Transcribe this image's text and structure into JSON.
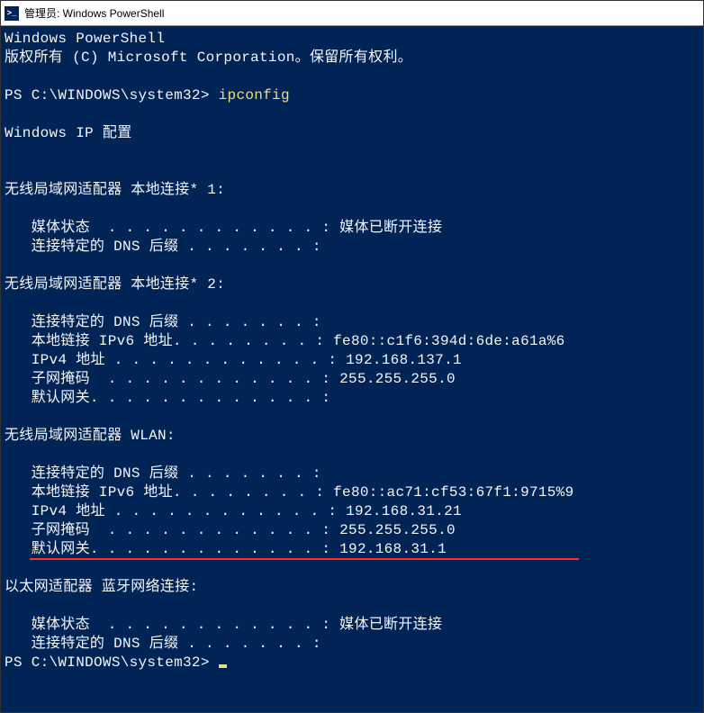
{
  "titlebar": {
    "icon_text": ">_",
    "title": "管理员: Windows PowerShell"
  },
  "terminal": {
    "header_line1": "Windows PowerShell",
    "header_line2": "版权所有 (C) Microsoft Corporation。保留所有权利。",
    "prompt1": "PS C:\\WINDOWS\\system32> ",
    "command1": "ipconfig",
    "ip_header": "Windows IP 配置",
    "adapter1_title": "无线局域网适配器 本地连接* 1:",
    "adapter1_media": "   媒体状态  . . . . . . . . . . . . : 媒体已断开连接",
    "adapter1_dns": "   连接特定的 DNS 后缀 . . . . . . . :",
    "adapter2_title": "无线局域网适配器 本地连接* 2:",
    "adapter2_dns": "   连接特定的 DNS 后缀 . . . . . . . :",
    "adapter2_ipv6": "   本地链接 IPv6 地址. . . . . . . . : fe80::c1f6:394d:6de:a61a%6",
    "adapter2_ipv4": "   IPv4 地址 . . . . . . . . . . . . : 192.168.137.1",
    "adapter2_mask": "   子网掩码  . . . . . . . . . . . . : 255.255.255.0",
    "adapter2_gw": "   默认网关. . . . . . . . . . . . . :",
    "adapter3_title": "无线局域网适配器 WLAN:",
    "adapter3_dns": "   连接特定的 DNS 后缀 . . . . . . . :",
    "adapter3_ipv6": "   本地链接 IPv6 地址. . . . . . . . : fe80::ac71:cf53:67f1:9715%9",
    "adapter3_ipv4": "   IPv4 地址 . . . . . . . . . . . . : 192.168.31.21",
    "adapter3_mask": "   子网掩码  . . . . . . . . . . . . : 255.255.255.0",
    "adapter3_gw": "   默认网关. . . . . . . . . . . . . : 192.168.31.1",
    "adapter4_title": "以太网适配器 蓝牙网络连接:",
    "adapter4_media": "   媒体状态  . . . . . . . . . . . . : 媒体已断开连接",
    "adapter4_dns": "   连接特定的 DNS 后缀 . . . . . . . :",
    "prompt2": "PS C:\\WINDOWS\\system32> "
  }
}
